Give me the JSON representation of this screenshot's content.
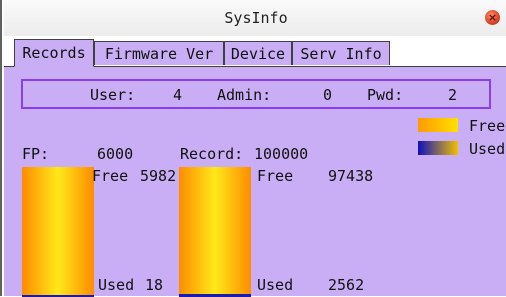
{
  "window": {
    "title": "SysInfo"
  },
  "tabs": [
    {
      "label": "Records",
      "active": true
    },
    {
      "label": "Firmware Ver",
      "active": false
    },
    {
      "label": "Device",
      "active": false
    },
    {
      "label": "Serv Info",
      "active": false
    }
  ],
  "summary": {
    "user_label": "User:",
    "user_value": "4",
    "admin_label": "Admin:",
    "admin_value": "0",
    "pwd_label": "Pwd:",
    "pwd_value": "2"
  },
  "legend": [
    {
      "label": "Free",
      "color": "#ffb000"
    },
    {
      "label": "Used",
      "color": "#1010c0"
    }
  ],
  "fp": {
    "label": "FP:",
    "capacity": "6000",
    "free_label": "Free",
    "free_value": "5982",
    "used_label": "Used",
    "used_value": "18",
    "used_fraction": 0.003
  },
  "record": {
    "label": "Record:",
    "capacity": "100000",
    "free_label": "Free",
    "free_value": "97438",
    "used_label": "Used",
    "used_value": "2562",
    "used_fraction": 0.0256
  },
  "colors": {
    "panel": "#c9aef5",
    "border": "#8a3cf0"
  }
}
